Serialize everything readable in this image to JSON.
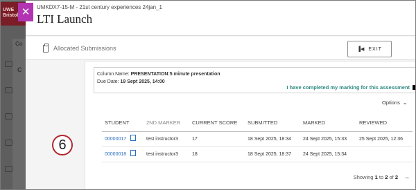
{
  "header": {
    "course_code": "UMKDX7-15-M - 21st century experiences 24jan_1",
    "title": "LTI Launch",
    "close_glyph": "✕"
  },
  "background": {
    "brand_text": "UWE\nBristol",
    "tab_text": "Co",
    "item_text": "C"
  },
  "subbar": {
    "label": "Allocated Submissions",
    "exit_label": "EXIT",
    "exit_icon": "▐◀"
  },
  "info": {
    "column_name_label": "Column Name:",
    "column_name_value": "PRESENTATION:5 minute presentation",
    "due_date_label": "Due Date:",
    "due_date_value": "19 Sept 2025, 14:00",
    "completed_text": "I have completed my marking for this assessment"
  },
  "options": {
    "label": "Options",
    "chevron": "⌄"
  },
  "table": {
    "headers": [
      "STUDENT",
      "2ND MARKER",
      "CURRENT SCORE",
      "SUBMITTED",
      "MARKED",
      "REVIEWED"
    ],
    "rows": [
      {
        "student": "00000017",
        "second_marker": "test instructor3",
        "score": "17",
        "submitted": "18 Sept 2025, 18:34",
        "marked": "24 Sept 2025, 15:33",
        "reviewed": "25 Sept 2025, 12:36"
      },
      {
        "student": "00000018",
        "second_marker": "test instructor3",
        "score": "18",
        "submitted": "18 Sept 2025, 18:37",
        "marked": "24 Sept 2025, 15:34",
        "reviewed": ""
      }
    ]
  },
  "pager": {
    "showing": "Showing",
    "from": "1",
    "to_word": "to",
    "to": "2",
    "of_word": "of",
    "total": "2",
    "next_glyph": "→"
  },
  "callout": {
    "step_number": "6"
  },
  "colors": {
    "accent_magenta": "#b234b3",
    "link_blue": "#2a6ebb",
    "teal": "#2e8a83",
    "callout_red": "#b3262f"
  }
}
